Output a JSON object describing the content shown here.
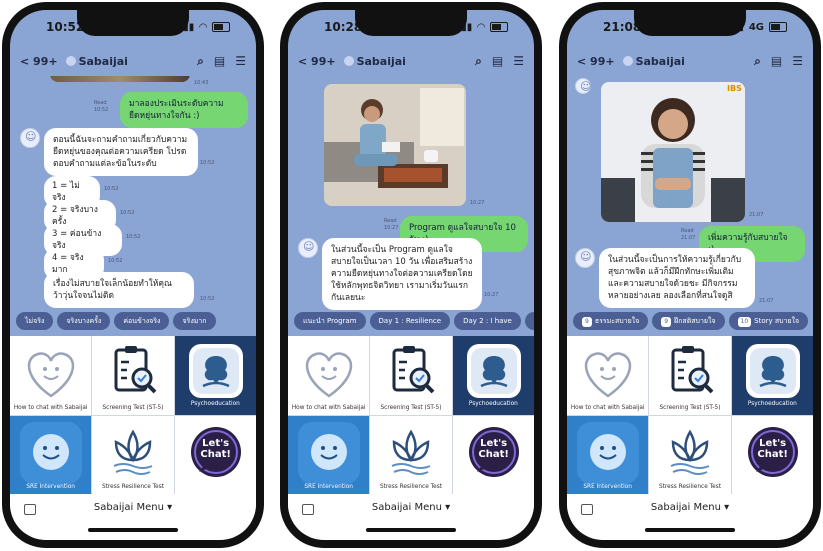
{
  "phones": [
    {
      "status": {
        "time": "10:52"
      },
      "header": {
        "back": "< 99+",
        "name": "Sabaijai"
      },
      "chat": {
        "photo_time": "10:43",
        "out_read": "Read",
        "out_time": "10:52",
        "out_text": "มาลองประเมินระดับความยืดหยุ่นทางใจกัน :)",
        "intro": "ตอนนี้ฉันจะถามคำถามเกี่ยวกับความยืดหยุ่นของคุณต่อความเครียด โปรดตอบคำถามแต่ละข้อในระดับ",
        "intro_time": "10:52",
        "options": [
          "1 = ไม่จริง",
          "2 = จริงบางครั้ง",
          "3 = ค่อนข้างจริง",
          "4 = จริงมาก"
        ],
        "option_times": [
          "10:52",
          "10:52",
          "10:52",
          "10:52"
        ],
        "closing": "เรื่องไม่สบายใจเล็กน้อยทำให้คุณว้าวุ่นใจจนไม่ติด",
        "closing_time": "10:52"
      },
      "quick_replies": [
        "ไม่จริง",
        "จริงบางครั้ง",
        "ค่อนข้างจริง",
        "จริงมาก"
      ],
      "tiles": [
        "How to chat with Sabaijai",
        "Screening Test (ST-5)",
        "Psychoeducation",
        "SRE Intervention",
        "Stress Resilience Test",
        "Let's Chat!"
      ],
      "menu_label": "Sabaijai Menu ▾"
    },
    {
      "status": {
        "time": "10:28"
      },
      "header": {
        "back": "< 99+",
        "name": "Sabaijai"
      },
      "chat": {
        "photo_time": "10:27",
        "out_read": "Read",
        "out_time": "10:27",
        "out_text": "Program ดูแลใจสบายใจ 10 วัน :)",
        "intro": "ในส่วนนี้จะเป็น Program ดูแลใจสบายใจเป็นเวลา 10 วัน เพื่อเสริมสร้างความยืดหยุ่นทางใจต่อความเครียดโดยใช้หลักพุทธจิตวิทยา เรามาเริ่มวันแรกกันเลยนะ",
        "intro_time": "10:27"
      },
      "quick_replies": [
        "แนะนำ Program",
        "Day 1 : Resilience",
        "Day 2 : I have",
        "D"
      ],
      "tiles": [
        "How to chat with Sabaijai",
        "Screening Test (ST-5)",
        "Psychoeducation",
        "SRE Intervention",
        "Stress Resilience Test",
        "Let's Chat!"
      ],
      "menu_label": "Sabaijai Menu ▾"
    },
    {
      "status": {
        "time": "21:08",
        "network": "4G"
      },
      "header": {
        "back": "< 99+",
        "name": "Sabaijai"
      },
      "chat": {
        "photo_badge": "IBS",
        "photo_time": "21:07",
        "out_read": "Read",
        "out_time": "21:07",
        "out_text": "เพิ่มความรู้กับสบายใจ :)",
        "intro": "ในส่วนนี้จะเป็นการให้ความรู้เกี่ยวกับสุขภาพจิต แล้วก็มีฝึกทักษะเพิ่มเติมและความสบายใจด้วยชะ มีกิจกรรมหลายอย่างเลย ลองเลือกที่สนใจดูสิ",
        "intro_time": "21:07"
      },
      "quick_replies": [
        {
          "num": "9",
          "label": "ธรรมะสบายใจ"
        },
        {
          "num": "9",
          "label": "ฝึกสติสบายใจ"
        },
        {
          "num": "10",
          "label": "Story สบายใจ"
        }
      ],
      "tiles": [
        "How to chat with Sabaijai",
        "Screening Test (ST-5)",
        "Psychoeducation",
        "SRE Intervention",
        "Stress Resilience Test",
        "Let's Chat!"
      ],
      "menu_label": "Sabaijai Menu ▾"
    }
  ]
}
